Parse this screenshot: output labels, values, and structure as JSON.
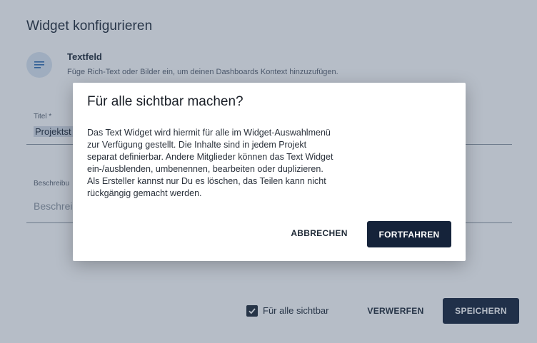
{
  "page": {
    "title": "Widget konfigurieren",
    "widget_type": {
      "icon": "text-lines-icon",
      "name": "Textfeld",
      "description": "Füge Rich-Text oder Bilder ein, um deinen Dashboards Kontext hinzuzufügen."
    },
    "fields": {
      "title_label": "Titel *",
      "title_value": "Projektst",
      "description_label": "Beschreibu",
      "description_placeholder": "Beschrei"
    },
    "footer": {
      "visible_checkbox_label": "Für alle sichtbar",
      "visible_checked": true,
      "discard_label": "VERWERFEN",
      "save_label": "SPEICHERN"
    }
  },
  "dialog": {
    "title": "Für alle sichtbar machen?",
    "body_lines": [
      "Das Text Widget wird hiermit für alle im Widget-Auswahlmenü",
      "zur Verfügung gestellt. Die Inhalte sind in jedem Projekt",
      "separat definierbar. Andere Mitglieder können das Text Widget",
      "ein-/ausblenden, umbenennen, bearbeiten oder duplizieren.",
      "Als Ersteller kannst nur Du es löschen, das Teilen kann nicht",
      "rückgängig gemacht werden."
    ],
    "cancel_label": "ABBRECHEN",
    "continue_label": "FORTFAHREN"
  },
  "colors": {
    "primary": "#15233a",
    "overlay": "#344863",
    "icon_bg": "#dbe6f3",
    "icon_fg": "#2f6db3"
  }
}
